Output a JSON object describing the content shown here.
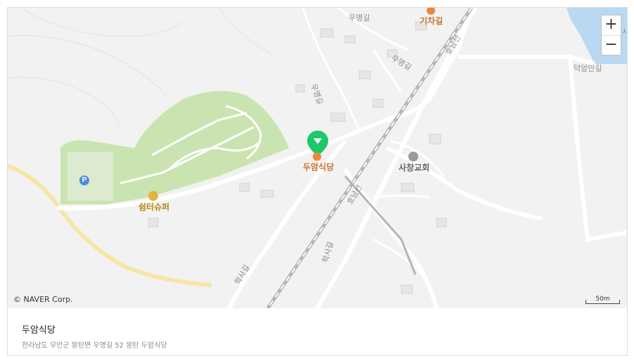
{
  "place": {
    "title": "두암식당",
    "address": "전라남도 무안군 몽탄면 우명길 52 몽탄 두암식당"
  },
  "map": {
    "controls": {
      "zoom_in": "+",
      "zoom_out": "−"
    },
    "copyright": "© NAVER Corp.",
    "scale_label": "50m",
    "streets": {
      "woomyeong_top": "우명길",
      "woomyeong_mid": "우명길",
      "woomyeong_vertical": "우명길",
      "deokam": "덕암안길",
      "hwasa": "학사길",
      "hwasa_lower": "학사길",
      "honam_top": "호남선",
      "honam_mid": "호남선",
      "partial_right": "사"
    },
    "pois": {
      "restaurant": "두암식당",
      "shop": "쉼터슈퍼",
      "church": "사창교회",
      "top_restaurant": "기차길"
    },
    "colors": {
      "marker": "#1ec86a",
      "park": "#c9e4b0",
      "water": "#b9d9f2",
      "main_road": "#f6e6a6",
      "poi_restaurant": "#e8893a"
    },
    "icons": [
      "parking-icon",
      "restaurant-icon",
      "shop-icon",
      "church-icon",
      "map-marker-icon"
    ]
  }
}
